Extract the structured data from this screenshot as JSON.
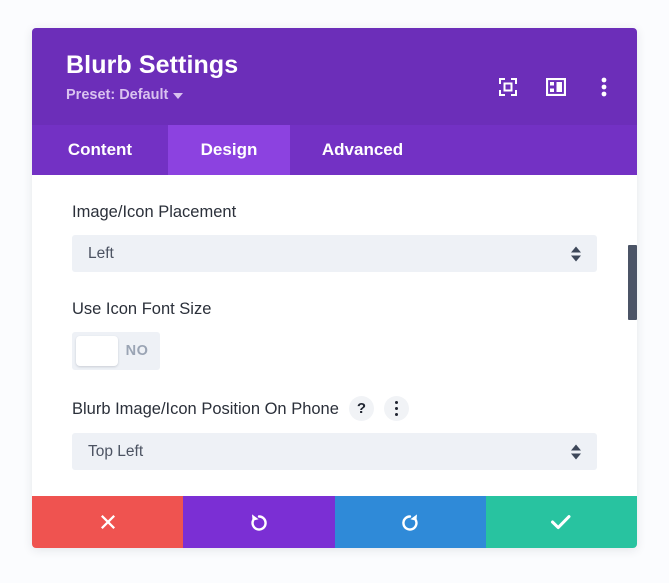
{
  "header": {
    "title": "Blurb Settings",
    "preset_label": "Preset: Default",
    "icons": [
      {
        "name": "focus-target-icon"
      },
      {
        "name": "layout-panel-icon"
      },
      {
        "name": "more-options-icon"
      }
    ]
  },
  "tabs": [
    {
      "label": "Content",
      "active": false
    },
    {
      "label": "Design",
      "active": true
    },
    {
      "label": "Advanced",
      "active": false
    }
  ],
  "fields": {
    "placement": {
      "label": "Image/Icon Placement",
      "value": "Left"
    },
    "icon_font_size": {
      "label": "Use Icon Font Size",
      "toggle_value": "NO"
    },
    "position_on_phone": {
      "label": "Blurb Image/Icon Position On Phone",
      "value": "Top Left",
      "help_icon": "?",
      "options_icon": "more-options-icon"
    }
  },
  "footer": {
    "cancel_label": "✖",
    "undo_label": "undo-icon",
    "redo_label": "redo-icon",
    "save_label": "check-icon"
  },
  "colors": {
    "header_purple": "#6c2eb9",
    "tabbar_purple": "#7331c4",
    "tab_active_purple": "#8c42e0",
    "cancel_red": "#ef5350",
    "undo_purple": "#7b2fd4",
    "redo_blue": "#2f8ad8",
    "save_teal": "#28c3a0",
    "field_bg": "#eef1f6",
    "scrollbar_thumb": "#4b5466"
  }
}
